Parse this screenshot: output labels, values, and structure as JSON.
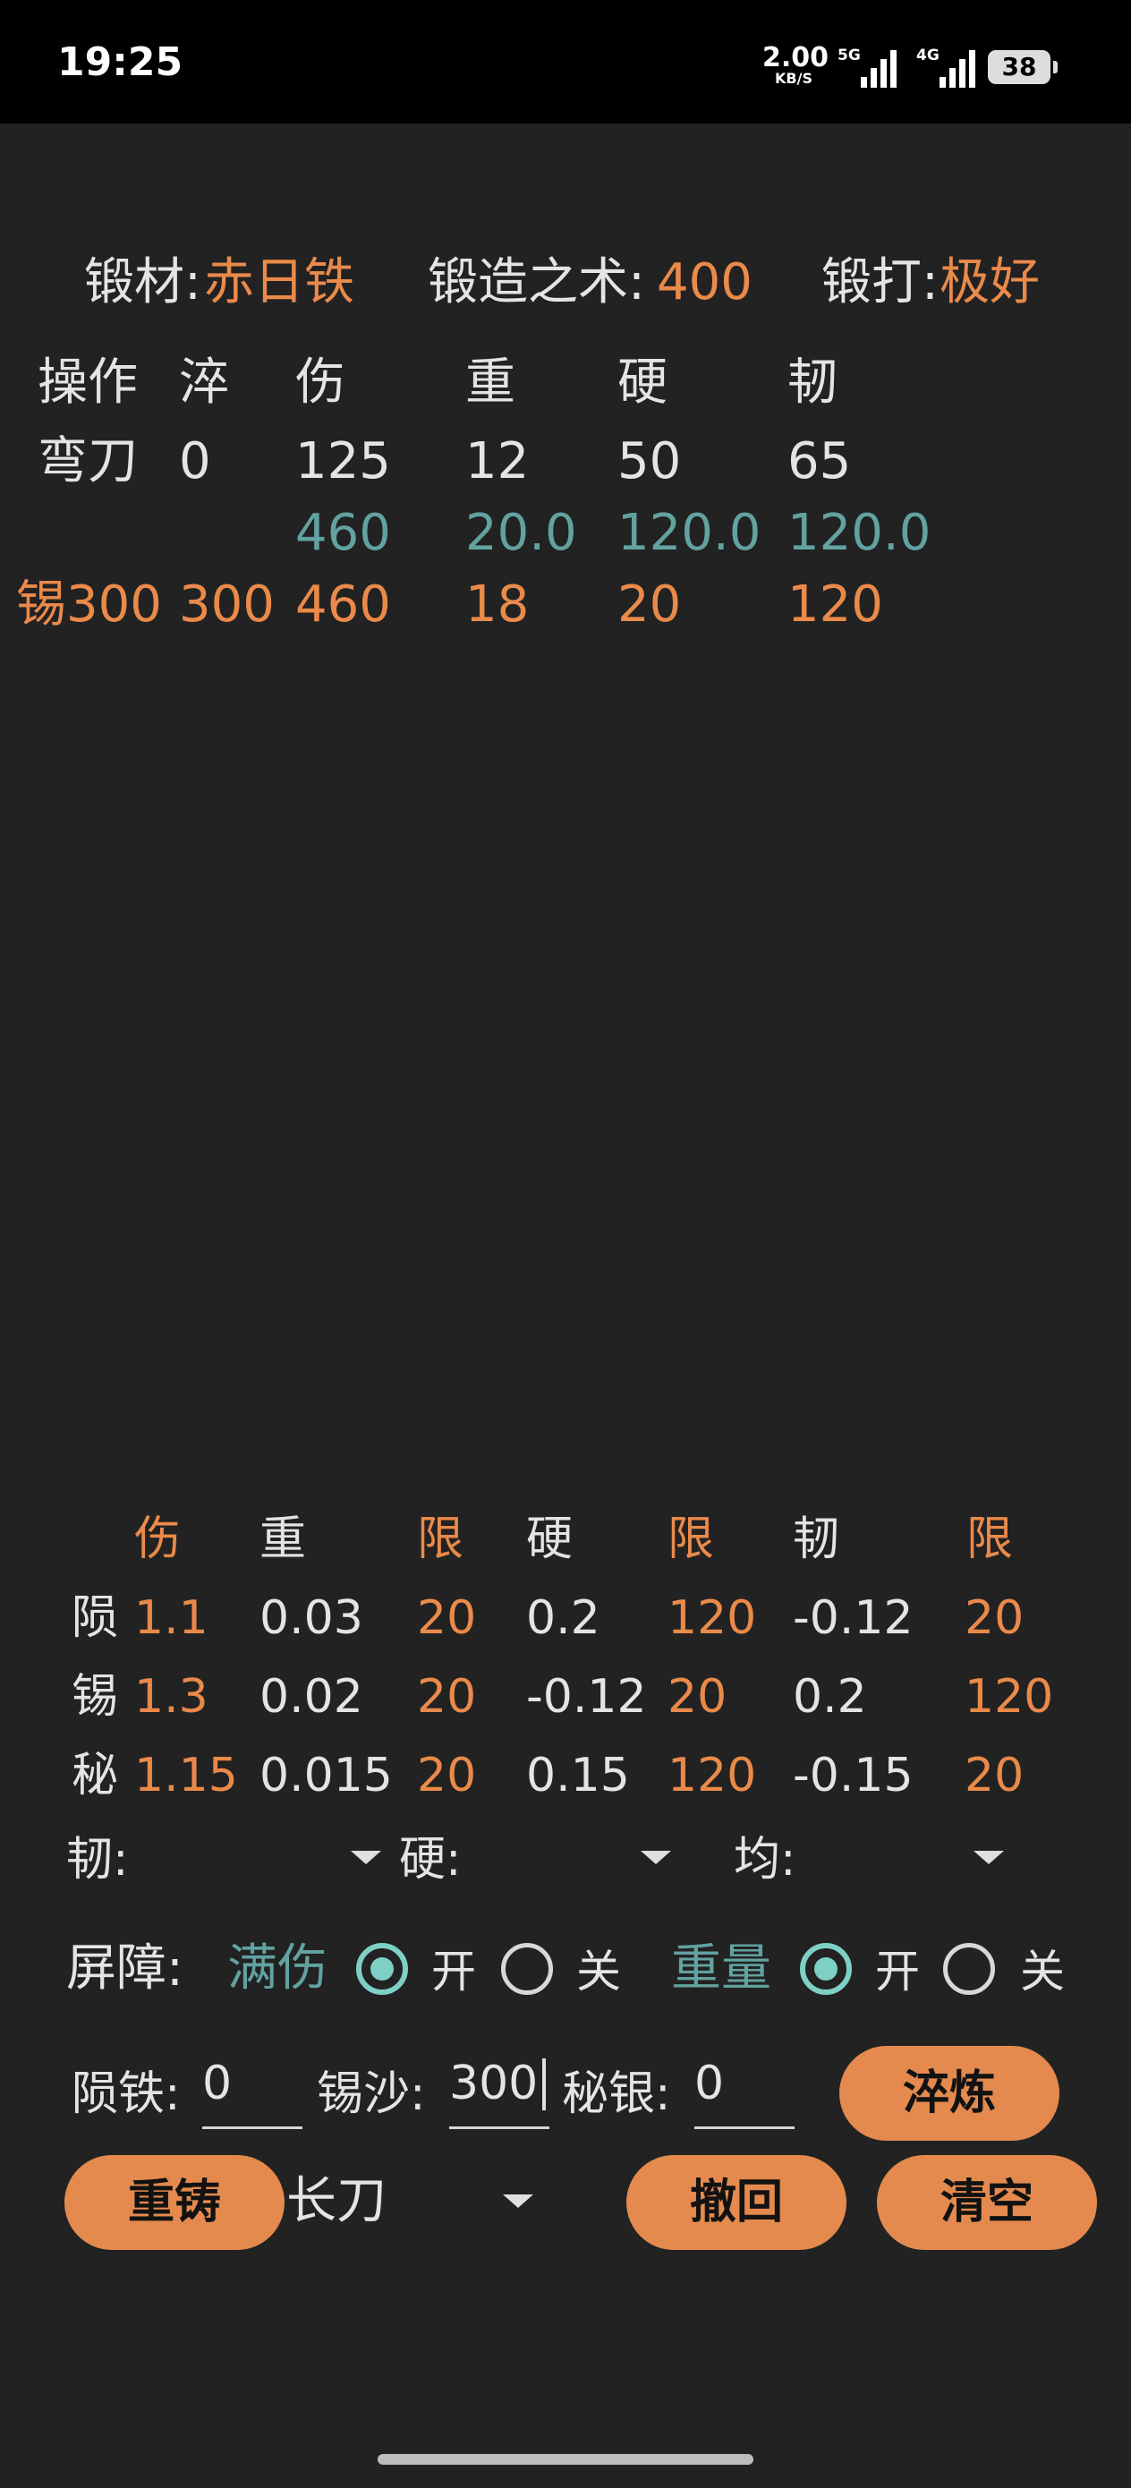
{
  "status_bar": {
    "time": "19:25",
    "net_speed": "2.00",
    "net_unit": "KB/S",
    "signal1": "5G",
    "signal2": "4G",
    "battery": "38"
  },
  "header": {
    "material_label": "锻材:",
    "material_value": "赤日铁",
    "skill_label": "锻造之术:",
    "skill_value": "400",
    "forge_label": "锻打:",
    "forge_value": "极好"
  },
  "stats_table": {
    "headers": [
      "操作",
      "淬",
      "伤",
      "重",
      "硬",
      "韧"
    ],
    "base_row": [
      "弯刀",
      "0",
      "125",
      "12",
      "50",
      "65"
    ],
    "limit_row": [
      "460",
      "20.0",
      "120.0",
      "120.0"
    ],
    "result_row": [
      "锡300",
      "300",
      "460",
      "18",
      "20",
      "120"
    ]
  },
  "coef_table": {
    "headers": [
      "伤",
      "重",
      "限",
      "硬",
      "限",
      "韧",
      "限"
    ],
    "rows": [
      {
        "name": "陨",
        "values": [
          "1.1",
          "0.03",
          "20",
          "0.2",
          "120",
          "-0.12",
          "20"
        ]
      },
      {
        "name": "锡",
        "values": [
          "1.3",
          "0.02",
          "20",
          "-0.12",
          "20",
          "0.2",
          "120"
        ]
      },
      {
        "name": "秘",
        "values": [
          "1.15",
          "0.015",
          "20",
          "0.15",
          "120",
          "-0.15",
          "20"
        ]
      }
    ]
  },
  "dropdowns": {
    "toughness_label": "韧:",
    "hardness_label": "硬:",
    "even_label": "均:"
  },
  "barrier": {
    "label": "屏障:",
    "full_damage_label": "满伤",
    "weight_label": "重量",
    "on_label": "开",
    "off_label": "关"
  },
  "inputs": {
    "meteor_label": "陨铁:",
    "meteor_value": "0",
    "tin_label": "锡沙:",
    "tin_value": "300",
    "mithril_label": "秘银:",
    "mithril_value": "0"
  },
  "buttons": {
    "quench": "淬炼",
    "recast": "重铸",
    "undo": "撤回",
    "clear": "清空"
  },
  "weapon_select": {
    "value": "长刀"
  },
  "colors": {
    "accent": "#e48a4e",
    "teal": "#62a2a0",
    "radio": "#7ed0c6",
    "background": "#222222"
  }
}
